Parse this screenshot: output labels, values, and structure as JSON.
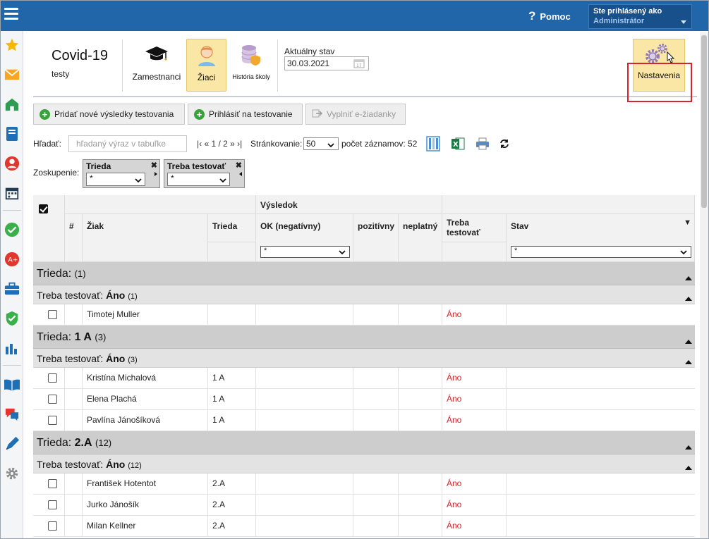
{
  "topbar": {
    "help_label": "Pomoc",
    "user_line1": "Ste prihlásený ako",
    "user_line2": "Administrátor"
  },
  "module": {
    "title": "Covid-19",
    "subtitle": "testy",
    "buttons": {
      "zamestnanci": "Zamestnanci",
      "ziaci": "Žiaci",
      "historia": "História školy"
    },
    "state_label": "Aktuálny stav",
    "state_value": "30.03.2021",
    "nastavenia": "Nastavenia"
  },
  "actions": {
    "add_results": "Pridať nové výsledky testovania",
    "register": "Prihlásiť na testovanie",
    "fill_form": "Vyplniť e-žiadanky"
  },
  "search": {
    "label": "Hľadať:",
    "placeholder": "hľadaný výraz v tabuľke",
    "pager": "|‹ « 1 / 2 » ›|",
    "paging_label": "Stránkovanie:",
    "page_size": "50",
    "count_label": "počet záznamov: 52"
  },
  "grouping": {
    "label": "Zoskupenie:",
    "boxes": [
      {
        "title": "Trieda",
        "value": "*"
      },
      {
        "title": "Treba testovať",
        "value": "*"
      }
    ]
  },
  "table": {
    "headers": {
      "num": "#",
      "student": "Žiak",
      "class": "Trieda",
      "result": "Výsledok",
      "ok": "OK (negatívny)",
      "positive": "pozitívny",
      "invalid": "neplatný",
      "need_line1": "Treba",
      "need_line2": "testovať",
      "state": "Stav"
    },
    "filters": {
      "ok": "*",
      "state": "*"
    },
    "groups": [
      {
        "label": "Trieda:",
        "name": "",
        "count": "(1)",
        "sub_label": "Treba testovať:",
        "sub_name": "Áno",
        "sub_count": "(1)",
        "rows": [
          {
            "student": "Timotej Muller",
            "class": "",
            "need": "Áno"
          }
        ]
      },
      {
        "label": "Trieda:",
        "name": "1 A",
        "count": "(3)",
        "sub_label": "Treba testovať:",
        "sub_name": "Áno",
        "sub_count": "(3)",
        "rows": [
          {
            "student": "Kristína Michalová",
            "class": "1 A",
            "need": "Áno"
          },
          {
            "student": "Elena Plachá",
            "class": "1 A",
            "need": "Áno"
          },
          {
            "student": "Pavlína Jánošíková",
            "class": "1 A",
            "need": "Áno"
          }
        ]
      },
      {
        "label": "Trieda:",
        "name": "2.A",
        "count": "(12)",
        "sub_label": "Treba testovať:",
        "sub_name": "Áno",
        "sub_count": "(12)",
        "rows": [
          {
            "student": "František Hotentot",
            "class": "2.A",
            "need": "Áno"
          },
          {
            "student": "Jurko Jánošík",
            "class": "2.A",
            "need": "Áno"
          },
          {
            "student": "Milan Kellner",
            "class": "2.A",
            "need": "Áno"
          }
        ]
      }
    ]
  },
  "icons": {
    "sidebar": [
      "star-icon",
      "mail-icon",
      "home-icon",
      "notebook-icon",
      "user-icon",
      "calendar-icon",
      "check-icon",
      "grade-icon",
      "briefcase-icon",
      "shield-check-icon",
      "bar-chart-icon",
      "book-icon",
      "chat-icon",
      "pen-icon",
      "gear-icon"
    ]
  },
  "colors": {
    "topbar": "#2066a8",
    "accent_yellow": "#fbe7a5",
    "red_text": "#d0232b",
    "highlight": "#d9232d"
  }
}
